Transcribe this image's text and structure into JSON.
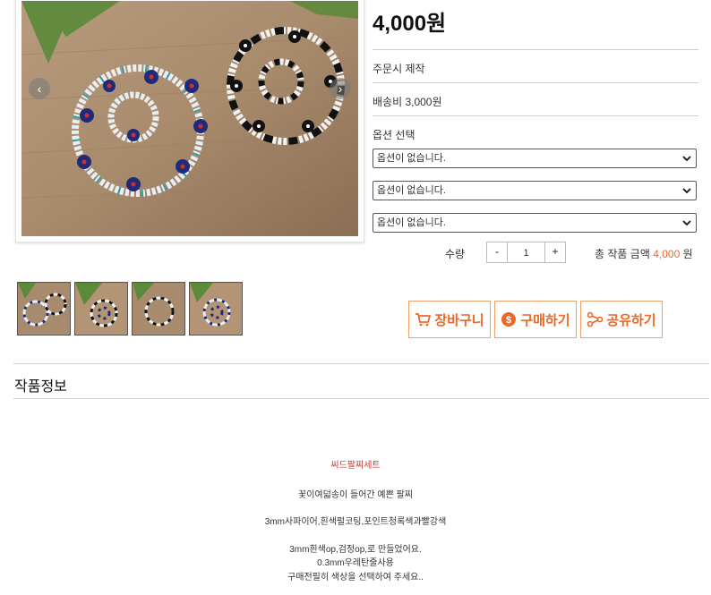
{
  "product": {
    "price": "4,000원",
    "info_rows": [
      "주문시 제작",
      "배송비 3,000원"
    ],
    "option_label": "옵션 선택",
    "options": [
      "옵션이 없습니다.",
      "옵션이 없습니다.",
      "옵션이 없습니다."
    ],
    "quantity_label": "수량",
    "quantity_minus": "-",
    "quantity_value": "1",
    "quantity_plus": "+",
    "total_label": "총 작품 금액",
    "total_amount": "4,000",
    "total_unit": "원"
  },
  "slider": {
    "prev_icon": "‹",
    "next_icon": "›"
  },
  "actions": {
    "cart": "장바구니",
    "buy": "구매하기",
    "share": "공유하기"
  },
  "section": {
    "title": "작품정보"
  },
  "description": {
    "heading": "씨드팔찌세트",
    "lines": [
      "꽃이여덟송이  들어간 예쁜 팔찌",
      "3mm사파이어,흰색펄코팅,포인트청록색과빨강색",
      "3mm흰색op,검정op,로 만들었어요.",
      "0.3mm우레탄줄사용",
      "구매전필히 색상을 선택하여 주세요.."
    ]
  },
  "colors": {
    "accent": "#e8692a",
    "red_text": "#c0392b"
  }
}
